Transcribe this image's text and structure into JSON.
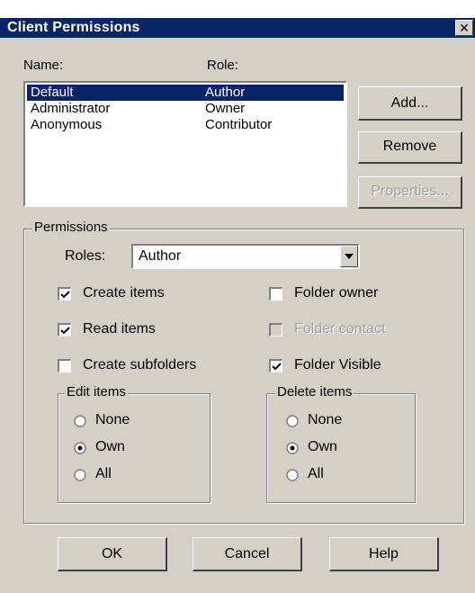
{
  "window": {
    "title": "Client Permissions",
    "close_glyph": "✕"
  },
  "list": {
    "name_header": "Name:",
    "role_header": "Role:",
    "rows": [
      {
        "name": "Default",
        "role": "Author",
        "selected": true
      },
      {
        "name": "Administrator",
        "role": "Owner",
        "selected": false
      },
      {
        "name": "Anonymous",
        "role": "Contributor",
        "selected": false
      }
    ]
  },
  "side_buttons": {
    "add": "Add...",
    "remove": "Remove",
    "properties": "Properties..."
  },
  "permissions": {
    "group_label": "Permissions",
    "roles_label": "Roles:",
    "roles_value": "Author",
    "checkboxes": {
      "create_items": {
        "label": "Create items",
        "checked": true
      },
      "read_items": {
        "label": "Read items",
        "checked": true
      },
      "create_subfolders": {
        "label": "Create subfolders",
        "checked": false
      },
      "folder_owner": {
        "label": "Folder owner",
        "checked": false
      },
      "folder_contact": {
        "label": "Folder contact",
        "checked": false,
        "disabled": true
      },
      "folder_visible": {
        "label": "Folder Visible",
        "checked": true
      }
    },
    "edit_items": {
      "label": "Edit items",
      "options": [
        "None",
        "Own",
        "All"
      ],
      "selected": "Own"
    },
    "delete_items": {
      "label": "Delete items",
      "options": [
        "None",
        "Own",
        "All"
      ],
      "selected": "Own"
    }
  },
  "footer": {
    "ok": "OK",
    "cancel": "Cancel",
    "help": "Help"
  }
}
